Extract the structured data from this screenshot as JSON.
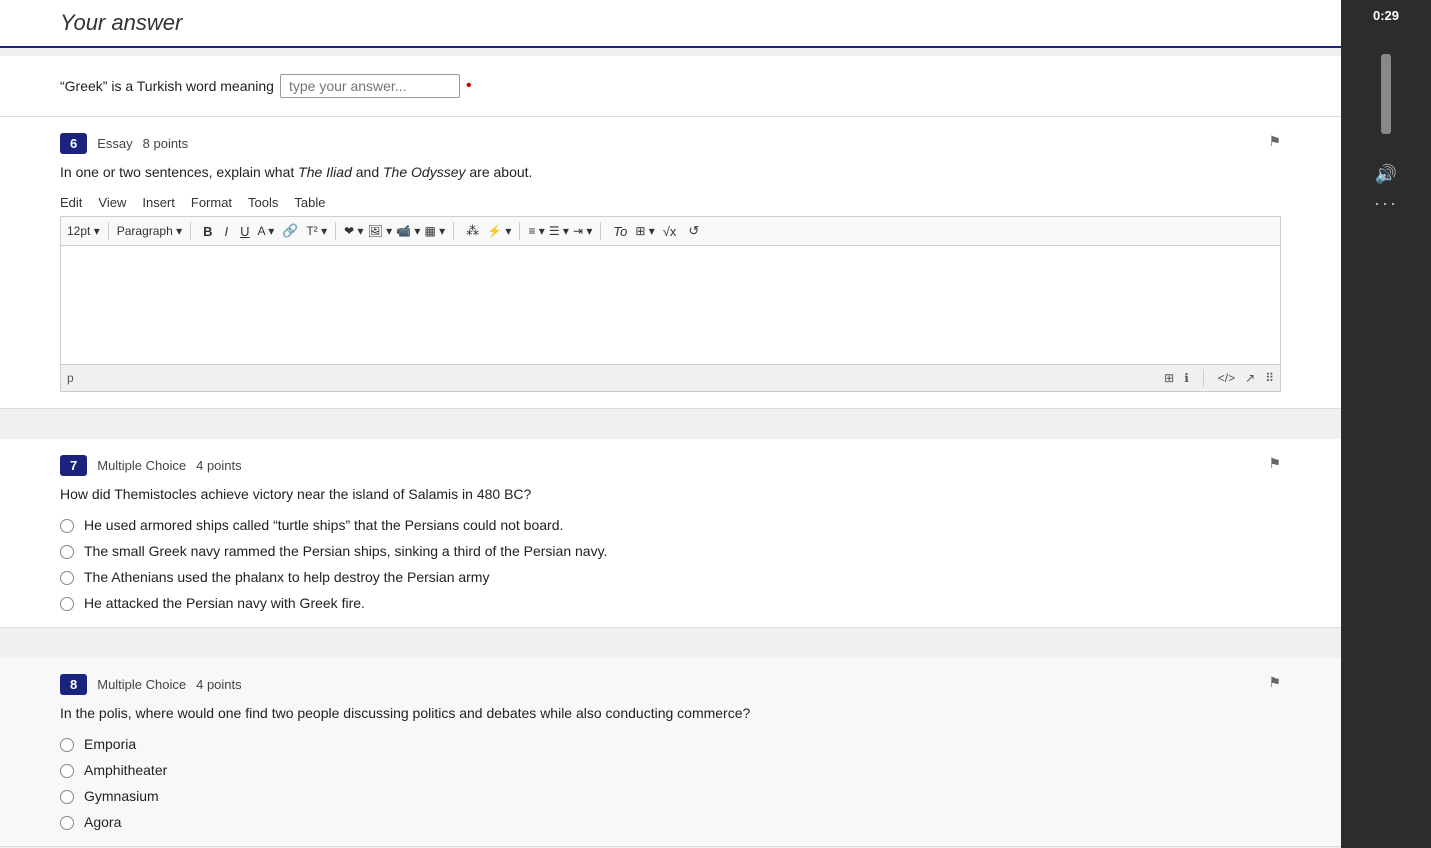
{
  "timer": "0:29",
  "topBar": {
    "title": "Your answer"
  },
  "question5": {
    "prefix": "“Greek” is a Turkish word meaning",
    "inputPlaceholder": "type your answer...",
    "required": true
  },
  "question6": {
    "number": "6",
    "type": "Essay",
    "points": "8 points",
    "text": "In one or two sentences, explain what The Iliad and The Odyssey are about.",
    "menubar": [
      "Edit",
      "View",
      "Insert",
      "Format",
      "Tools",
      "Table"
    ],
    "toolbar": {
      "fontSize": "12pt",
      "paragraph": "Paragraph",
      "bold": "B",
      "italic": "I",
      "underline": "U"
    },
    "footerTag": "p"
  },
  "question7": {
    "number": "7",
    "type": "Multiple Choice",
    "points": "4 points",
    "text": "How did Themistocles achieve victory near the island of Salamis in 480 BC?",
    "options": [
      "He used armored ships called “turtle ships” that the Persians could not board.",
      "The small Greek navy rammed the Persian ships, sinking a third of the Persian navy.",
      "The Athenians used the phalanx to help destroy the Persian army",
      "He attacked the Persian navy with Greek fire."
    ]
  },
  "question8": {
    "number": "8",
    "type": "Multiple Choice",
    "points": "4 points",
    "text": "In the polis, where would one find two people discussing politics and debates while also conducting commerce?",
    "options": [
      "Emporia",
      "Amphitheater",
      "Gymnasium",
      "Agora"
    ]
  }
}
